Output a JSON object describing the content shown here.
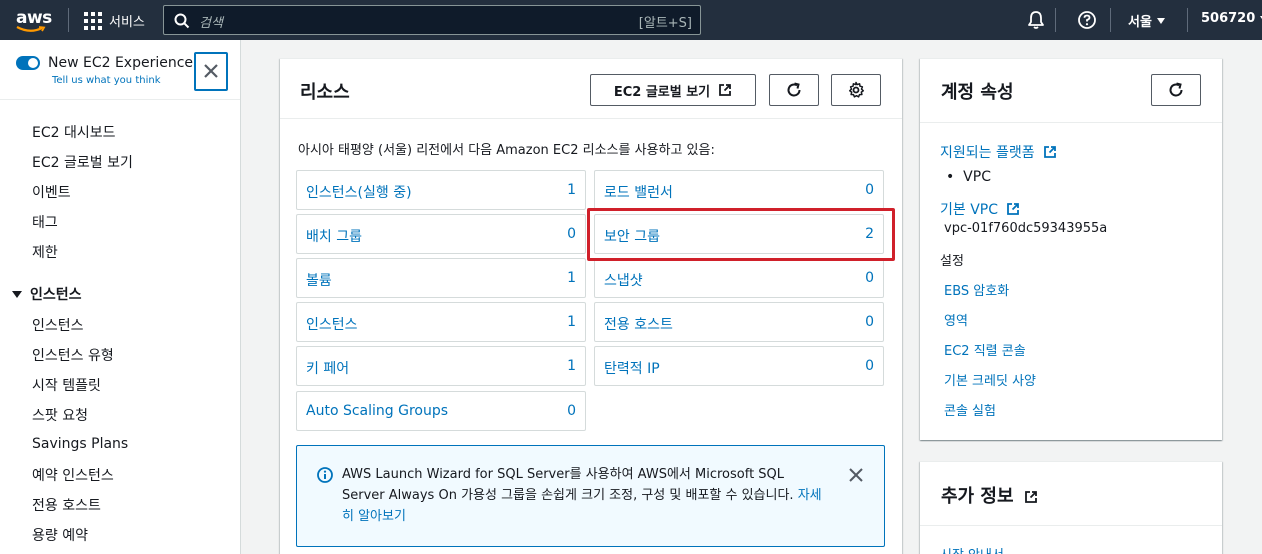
{
  "topnav": {
    "logo": "aws",
    "services_label": "서비스",
    "search_placeholder": "검색",
    "search_shortcut": "[알트+S]",
    "region": "서울",
    "account": "506720"
  },
  "sidebar": {
    "new_experience": "New EC2 Experience",
    "tell_us": "Tell us what you think",
    "top_items": [
      "EC2 대시보드",
      "EC2 글로벌 보기",
      "이벤트",
      "태그",
      "제한"
    ],
    "section_instances": "인스턴스",
    "instance_items": [
      "인스턴스",
      "인스턴스 유형",
      "시작 템플릿",
      "스팟 요청",
      "Savings Plans",
      "예약 인스턴스",
      "전용 호스트",
      "용량 예약"
    ]
  },
  "resources": {
    "title": "리소스",
    "global_view_button": "EC2 글로벌 보기",
    "description": "아시아 태평양 (서울) 리전에서 다음 Amazon EC2 리소스를 사용하고 있음:",
    "items": [
      {
        "label": "인스턴스(실행 중)",
        "count": "1"
      },
      {
        "label": "로드 밸런서",
        "count": "0"
      },
      {
        "label": "배치 그룹",
        "count": "0"
      },
      {
        "label": "보안 그룹",
        "count": "2"
      },
      {
        "label": "볼륨",
        "count": "1"
      },
      {
        "label": "스냅샷",
        "count": "0"
      },
      {
        "label": "인스턴스",
        "count": "1"
      },
      {
        "label": "전용 호스트",
        "count": "0"
      },
      {
        "label": "키 페어",
        "count": "1"
      },
      {
        "label": "탄력적 IP",
        "count": "0"
      },
      {
        "label": "Auto Scaling Groups",
        "count": "0"
      }
    ],
    "info": {
      "text": "AWS Launch Wizard for SQL Server를 사용하여 AWS에서 Microsoft SQL Server Always On 가용성 그룹을 손쉽게 크기 조정, 구성 및 배포할 수 있습니다.",
      "link": "자세히 알아보기"
    }
  },
  "account_attributes": {
    "title": "계정 속성",
    "supported_platforms": "지원되는 플랫폼",
    "platform_value": "VPC",
    "default_vpc": "기본 VPC",
    "vpc_id": "vpc-01f760dc59343955a",
    "settings_label": "설정",
    "settings_links": [
      "EBS 암호화",
      "영역",
      "EC2 직렬 콘솔",
      "기본 크레딧 사양",
      "콘솔 실험"
    ]
  },
  "additional_info": {
    "title": "추가 정보",
    "first_link": "시작 안내서"
  },
  "colors": {
    "nav_bg": "#232f3e",
    "link": "#0073bb",
    "highlight": "#d0202a",
    "info_bg": "#f1faff"
  }
}
